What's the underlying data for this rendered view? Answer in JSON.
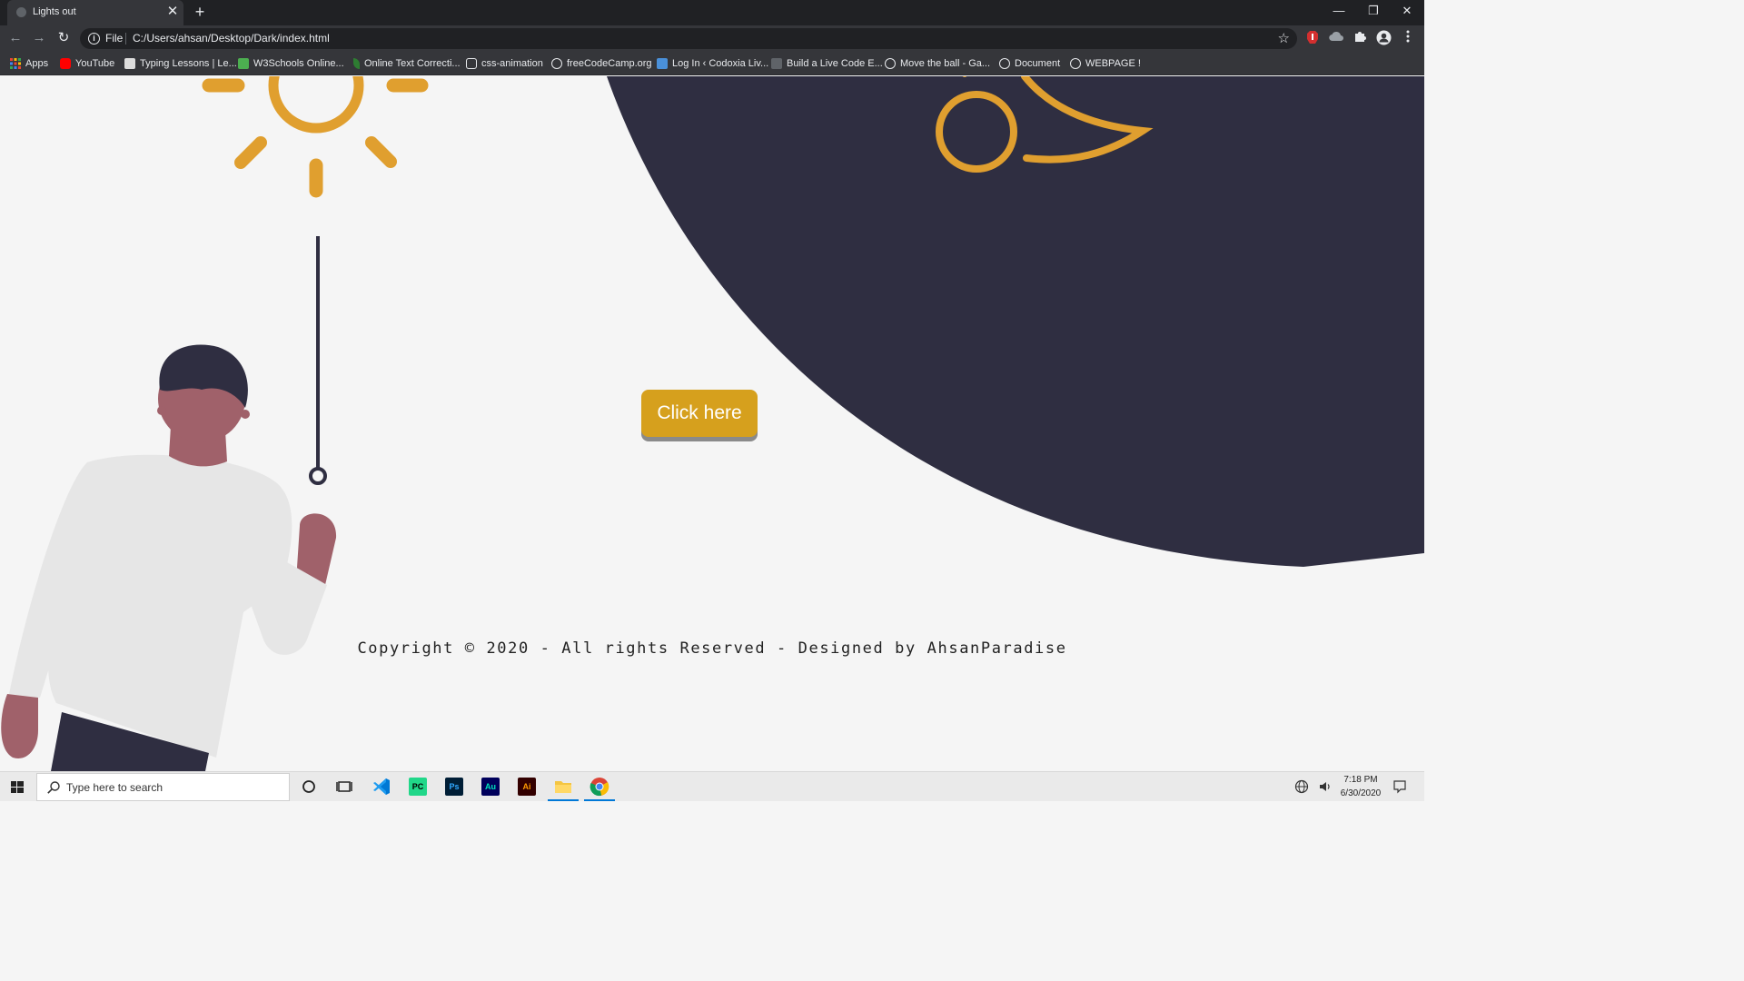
{
  "browser": {
    "tab": {
      "title": "Lights out",
      "close": "✕"
    },
    "new_tab": "+",
    "window_controls": {
      "minimize": "—",
      "restore": "❐",
      "close": "✕"
    },
    "toolbar": {
      "back": "←",
      "forward": "→",
      "reload": "↻"
    },
    "address": {
      "scheme_label": "File",
      "url": "C:/Users/ahsan/Desktop/Dark/index.html",
      "info": "i",
      "star": "☆"
    },
    "bookmarks": [
      {
        "label": "Apps",
        "icon": "apps-grid-icon",
        "color": "#ea4335"
      },
      {
        "label": "YouTube",
        "icon": "youtube-icon",
        "color": "#ff0000"
      },
      {
        "label": "Typing Lessons | Le...",
        "icon": "typing-icon",
        "color": "#dddddd"
      },
      {
        "label": "W3Schools Online...",
        "icon": "w3schools-icon",
        "color": "#4caf50"
      },
      {
        "label": "Online Text Correcti...",
        "icon": "leaf-icon",
        "color": "#2e7d32"
      },
      {
        "label": "css-animation",
        "icon": "css-icon",
        "color": "#e8eaed"
      },
      {
        "label": "freeCodeCamp.org",
        "icon": "freecodecamp-icon",
        "color": "#e8eaed"
      },
      {
        "label": "Log In ‹ Codoxia Liv...",
        "icon": "codoxia-icon",
        "color": "#4a90d9"
      },
      {
        "label": "Build a Live Code E...",
        "icon": "code-icon",
        "color": "#5f6368"
      },
      {
        "label": "Move the ball - Ga...",
        "icon": "globe-icon",
        "color": "#e8eaed"
      },
      {
        "label": "Document",
        "icon": "globe-icon",
        "color": "#e8eaed"
      },
      {
        "label": "WEBPAGE !",
        "icon": "globe-icon",
        "color": "#e8eaed"
      }
    ]
  },
  "page": {
    "button_label": "Click here",
    "copyright": "Copyright © 2020 - All rights Reserved - Designed by AhsanParadise",
    "colors": {
      "background": "#f5f5f5",
      "dark": "#2f2e41",
      "accent": "#e09f2f",
      "button": "#d6a01d",
      "skin": "#a0616a"
    }
  },
  "taskbar": {
    "search_placeholder": "Type here to search",
    "apps": [
      {
        "name": "vscode",
        "label": ""
      },
      {
        "name": "pycharm",
        "label": "PC"
      },
      {
        "name": "photoshop",
        "label": "Ps"
      },
      {
        "name": "audition",
        "label": "Au"
      },
      {
        "name": "illustrator",
        "label": "Ai"
      },
      {
        "name": "file-explorer",
        "label": ""
      },
      {
        "name": "chrome",
        "label": ""
      }
    ],
    "clock": {
      "time": "7:18 PM",
      "date": "6/30/2020"
    }
  }
}
